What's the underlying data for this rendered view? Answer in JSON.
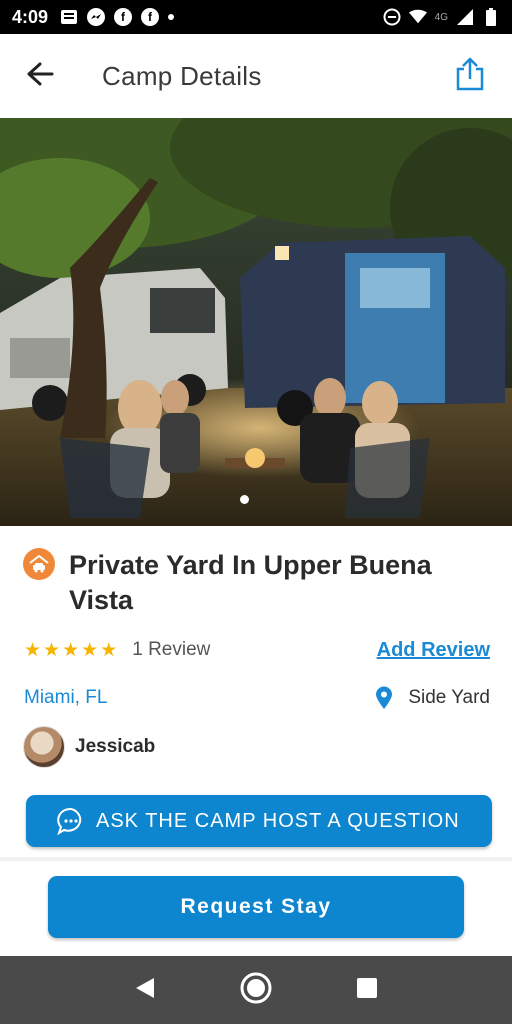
{
  "status_bar": {
    "time": "4:09",
    "network": "4G",
    "icons": [
      "news-icon",
      "messenger-icon",
      "facebook-icon",
      "facebook-icon",
      "dot-icon",
      "do-not-disturb-icon",
      "wifi-icon",
      "signal-icon",
      "battery-icon"
    ]
  },
  "app_bar": {
    "title": "Camp Details",
    "back_icon": "arrow-left-icon",
    "share_icon": "share-icon"
  },
  "hero": {
    "image_description_icon": "campsite-photo",
    "carousel_index": 1
  },
  "listing": {
    "type_icon": "car-in-house-icon",
    "title": "Private Yard In Upper Buena Vista",
    "rating": 5,
    "review_count_label": "1 Review",
    "add_review_label": "Add Review",
    "city": "Miami, FL",
    "yard_type": "Side Yard"
  },
  "host": {
    "name": "Jessicab"
  },
  "actions": {
    "ask_label": "ASK THE CAMP HOST A QUESTION",
    "request_label": "Request Stay"
  },
  "colors": {
    "accent": "#0d86cf",
    "star": "#f5b400",
    "badge": "#f0883a"
  }
}
